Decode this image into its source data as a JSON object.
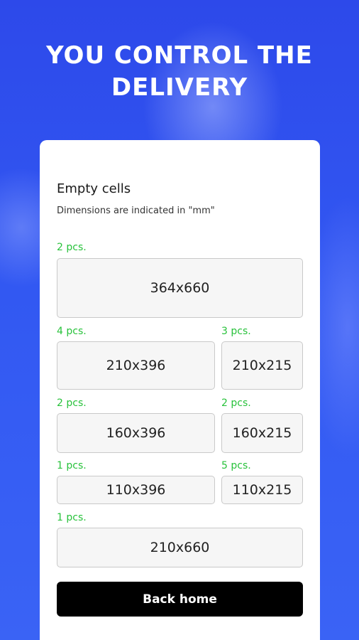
{
  "hero": {
    "title": "YOU CONTROL THE DELIVERY"
  },
  "card": {
    "title": "Empty cells",
    "subtitle": "Dimensions are indicated in \"mm\""
  },
  "cells": [
    {
      "qty": "2 pcs.",
      "size": "364x660"
    },
    {
      "qty": "4 pcs.",
      "size": "210x396"
    },
    {
      "qty": "3 pcs.",
      "size": "210x215"
    },
    {
      "qty": "2 pcs.",
      "size": "160x396"
    },
    {
      "qty": "2 pcs.",
      "size": "160x215"
    },
    {
      "qty": "1 pcs.",
      "size": "110x396"
    },
    {
      "qty": "5 pcs.",
      "size": "110x215"
    },
    {
      "qty": "1 pcs.",
      "size": "210x660"
    }
  ],
  "button": {
    "label": "Back home"
  }
}
